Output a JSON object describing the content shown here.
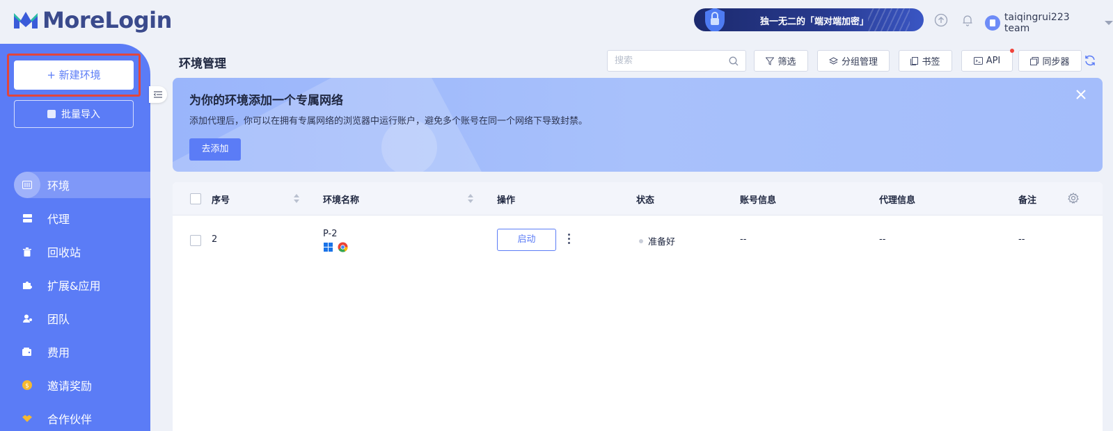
{
  "header": {
    "app_name": "MoreLogin",
    "promo_text": "独一无二的「端对端加密」",
    "user_name": "taiqingrui223 team"
  },
  "sidebar": {
    "new_env_label": "+ 新建环境",
    "batch_import_label": "批量导入",
    "nav_items": [
      {
        "label": "环境",
        "icon": "environment-icon",
        "active": true
      },
      {
        "label": "代理",
        "icon": "proxy-icon"
      },
      {
        "label": "回收站",
        "icon": "trash-icon"
      },
      {
        "label": "扩展&应用",
        "icon": "puzzle-icon"
      },
      {
        "label": "团队",
        "icon": "team-icon"
      },
      {
        "label": "费用",
        "icon": "wallet-icon"
      },
      {
        "label": "邀请奖励",
        "icon": "coin-icon"
      },
      {
        "label": "合作伙伴",
        "icon": "handshake-icon"
      }
    ]
  },
  "main": {
    "title": "环境管理",
    "search_placeholder": "搜索",
    "toolbar": {
      "filter_label": "筛选",
      "group_label": "分组管理",
      "bookmark_label": "书签",
      "api_label": "API",
      "sync_label": "同步器"
    },
    "banner": {
      "title": "为你的环境添加一个专属网络",
      "description": "添加代理后，你可以在拥有专属网络的浏览器中运行账户，避免多个账号在同一个网络下导致封禁。",
      "button_label": "去添加"
    },
    "table": {
      "columns": [
        "序号",
        "环境名称",
        "操作",
        "状态",
        "账号信息",
        "代理信息",
        "备注"
      ],
      "rows": [
        {
          "index": "2",
          "env_name": "P-2",
          "action_label": "启动",
          "status": "准备好",
          "account_info": "--",
          "proxy_info": "--",
          "note": "--"
        }
      ]
    }
  },
  "colors": {
    "accent": "#5b7cf6",
    "highlight_border": "#e2453c"
  }
}
